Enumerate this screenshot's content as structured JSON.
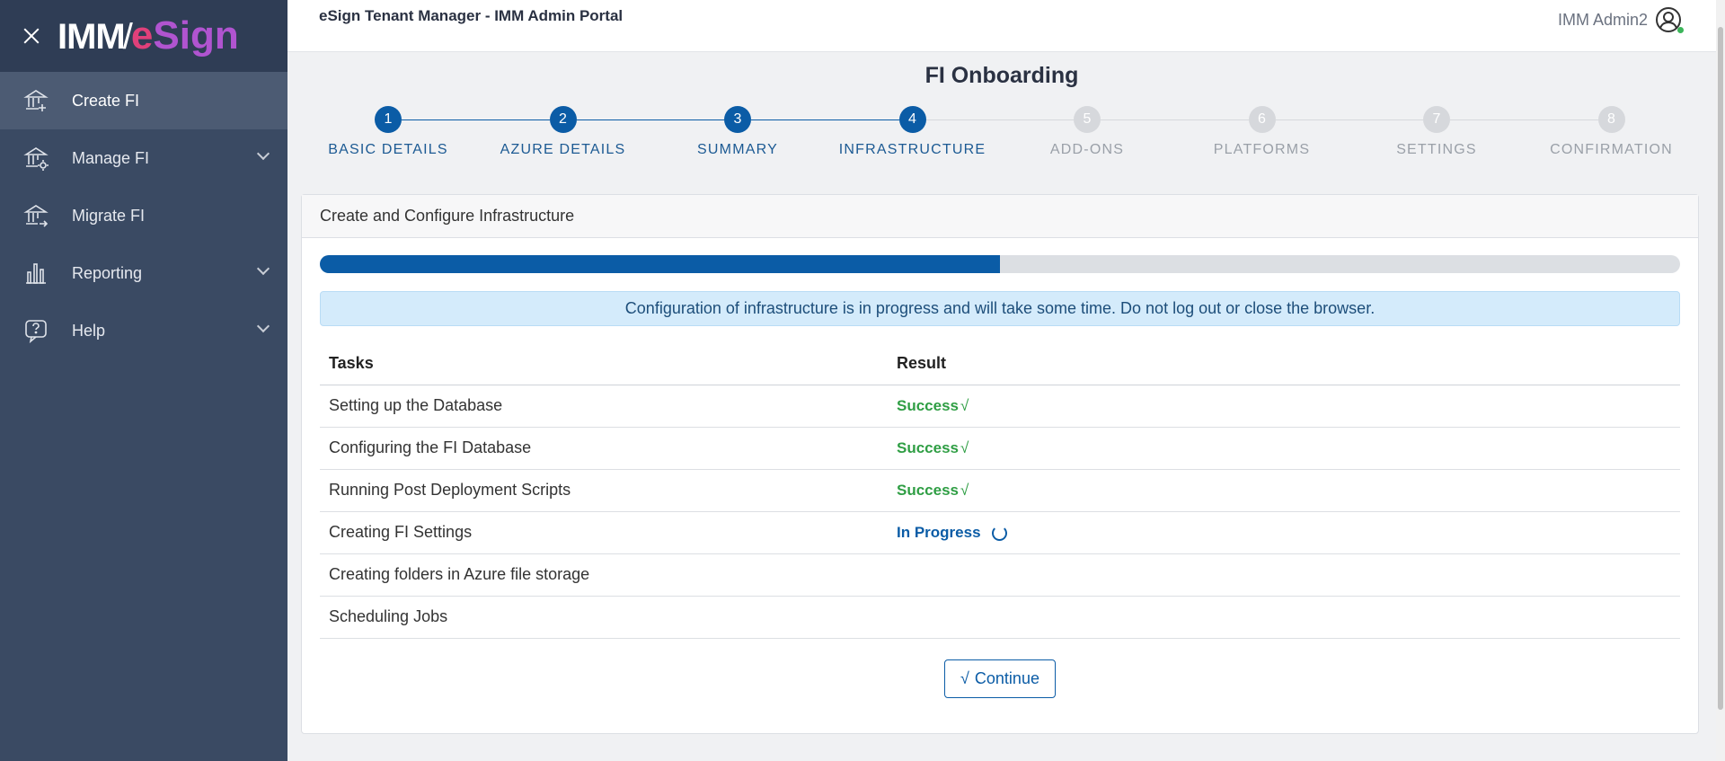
{
  "sidebar": {
    "logo": {
      "imm": "IMM",
      "slash": "/",
      "esign_e": "e",
      "esign_sign": "Sign"
    },
    "items": [
      {
        "label": "Create FI",
        "icon": "bank-add-icon",
        "active": true,
        "expandable": false
      },
      {
        "label": "Manage FI",
        "icon": "bank-settings-icon",
        "active": false,
        "expandable": true
      },
      {
        "label": "Migrate FI",
        "icon": "bank-migrate-icon",
        "active": false,
        "expandable": false
      },
      {
        "label": "Reporting",
        "icon": "bar-chart-icon",
        "active": false,
        "expandable": true
      },
      {
        "label": "Help",
        "icon": "help-icon",
        "active": false,
        "expandable": true
      }
    ]
  },
  "topbar": {
    "title": "eSign Tenant Manager - IMM Admin Portal",
    "user": "IMM Admin2"
  },
  "page": {
    "title": "FI Onboarding"
  },
  "stepper": {
    "current": 4,
    "steps": [
      {
        "num": "1",
        "label": "BASIC DETAILS"
      },
      {
        "num": "2",
        "label": "AZURE DETAILS"
      },
      {
        "num": "3",
        "label": "SUMMARY"
      },
      {
        "num": "4",
        "label": "INFRASTRUCTURE"
      },
      {
        "num": "5",
        "label": "ADD-ONS"
      },
      {
        "num": "6",
        "label": "PLATFORMS"
      },
      {
        "num": "7",
        "label": "SETTINGS"
      },
      {
        "num": "8",
        "label": "CONFIRMATION"
      }
    ]
  },
  "card": {
    "title": "Create and Configure Infrastructure",
    "progress_percent": 50,
    "alert": "Configuration of infrastructure is in progress and will take some time. Do not log out or close the browser.",
    "table": {
      "headers": [
        "Tasks",
        "Result"
      ],
      "rows": [
        {
          "task": "Setting up the Database",
          "result": "Success",
          "status": "success"
        },
        {
          "task": "Configuring the FI Database",
          "result": "Success",
          "status": "success"
        },
        {
          "task": "Running Post Deployment Scripts",
          "result": "Success",
          "status": "success"
        },
        {
          "task": "Creating FI Settings",
          "result": "In Progress",
          "status": "progress"
        },
        {
          "task": "Creating folders in Azure file storage",
          "result": "",
          "status": "pending"
        },
        {
          "task": "Scheduling Jobs",
          "result": "",
          "status": "pending"
        }
      ]
    },
    "continue_label": "Continue",
    "check_glyph": "√"
  },
  "colors": {
    "primary": "#0b5ca6",
    "success": "#2f9e44",
    "sidebar": "#3a4a63"
  }
}
